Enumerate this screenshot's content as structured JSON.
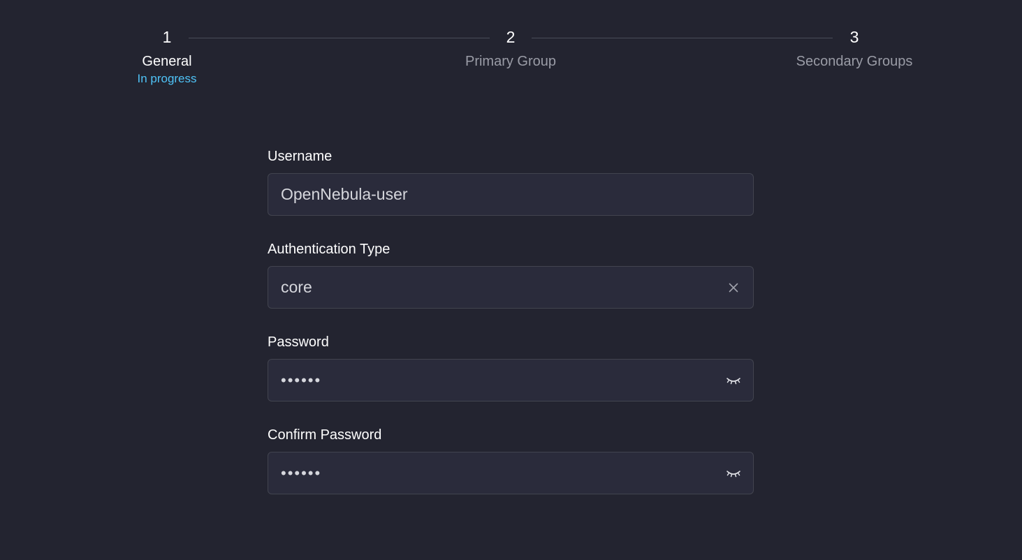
{
  "stepper": {
    "steps": [
      {
        "number": "1",
        "label": "General",
        "status": "In progress",
        "active": true
      },
      {
        "number": "2",
        "label": "Primary Group",
        "status": "",
        "active": false
      },
      {
        "number": "3",
        "label": "Secondary Groups",
        "status": "",
        "active": false
      }
    ]
  },
  "form": {
    "username": {
      "label": "Username",
      "value": "OpenNebula-user"
    },
    "auth_type": {
      "label": "Authentication Type",
      "value": "core"
    },
    "password": {
      "label": "Password",
      "value": "••••••"
    },
    "confirm_password": {
      "label": "Confirm Password",
      "value": "••••••"
    }
  },
  "icons": {
    "clear": "close-icon",
    "visibility": "eye-closed-icon"
  },
  "colors": {
    "background": "#232430",
    "field_background": "#2a2b3b",
    "accent": "#4fc3f7",
    "muted_text": "#9a9ca6"
  }
}
